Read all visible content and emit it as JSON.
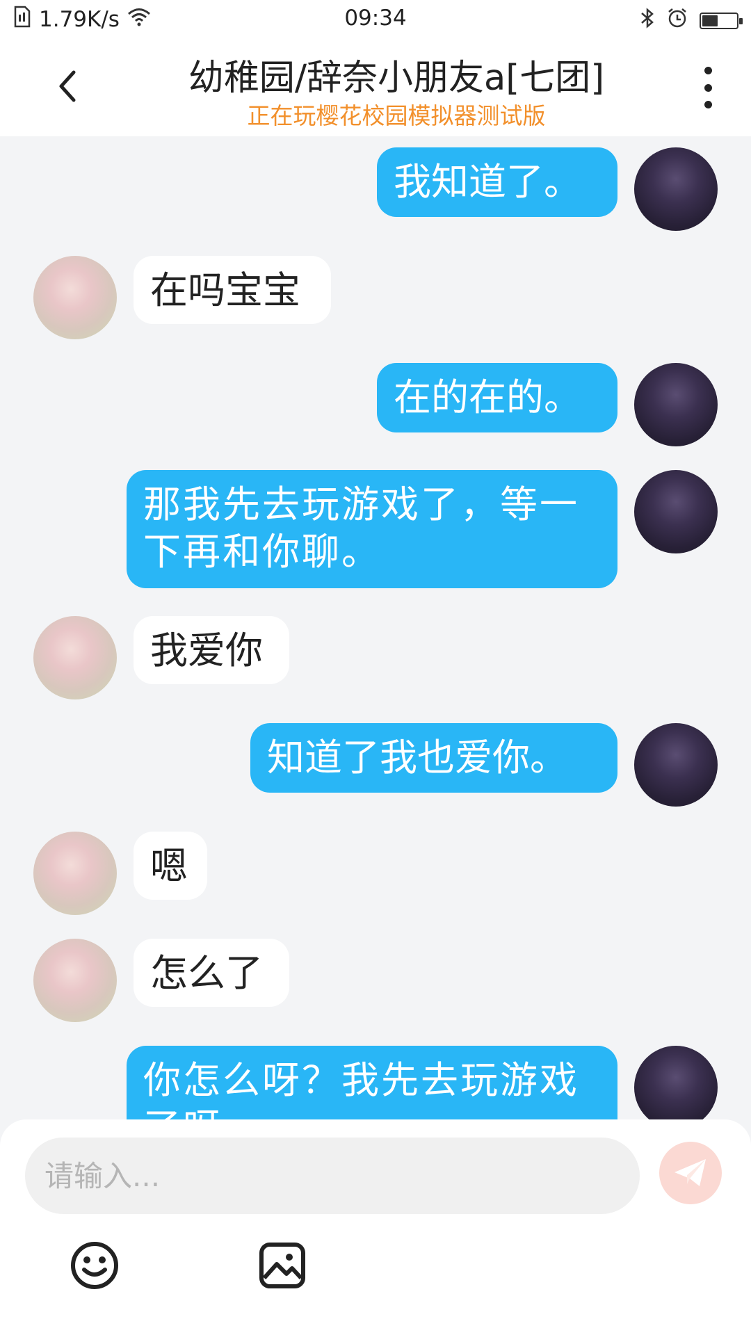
{
  "status_bar": {
    "network_speed": "1.79K/s",
    "time": "09:34",
    "battery_level": 0.5
  },
  "header": {
    "title": "幼稚园/辞奈小朋友a[七团]",
    "subtitle": "正在玩樱花校园模拟器测试版",
    "subtitle_color": "#f2902c"
  },
  "messages": [
    {
      "side": "out",
      "text": "我知道了。"
    },
    {
      "side": "in",
      "text": "在吗宝宝"
    },
    {
      "side": "out",
      "text": "在的在的。"
    },
    {
      "side": "out",
      "text": "那我先去玩游戏了，等一下再和你聊。"
    },
    {
      "side": "in",
      "text": "我爱你"
    },
    {
      "side": "out",
      "text": "知道了我也爱你。"
    },
    {
      "side": "in",
      "text": "嗯"
    },
    {
      "side": "in",
      "text": "怎么了"
    },
    {
      "side": "out",
      "text": "你怎么呀？我先去玩游戏了呀。"
    }
  ],
  "colors": {
    "outgoing_bubble": "#29b6f6",
    "incoming_bubble": "#ffffff",
    "background": "#f3f4f6"
  },
  "input": {
    "placeholder": "请输入...",
    "value": ""
  },
  "icons": {
    "back": "chevron-left-icon",
    "menu": "more-vertical-icon",
    "send": "paper-plane-icon",
    "emoji": "smiley-icon",
    "image": "image-icon",
    "wifi": "wifi-icon",
    "bluetooth": "bluetooth-icon",
    "alarm": "alarm-icon",
    "sim": "sim-card-icon"
  }
}
